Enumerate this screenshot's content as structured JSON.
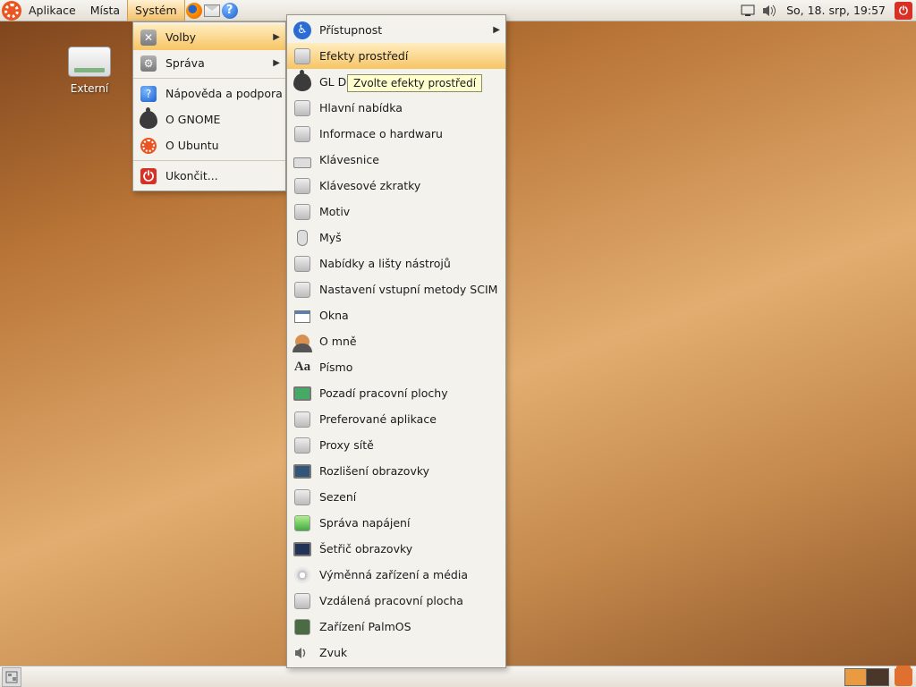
{
  "panel": {
    "apps": "Aplikace",
    "places": "Místa",
    "system": "Systém",
    "clock": "So, 18. srp, 19:57"
  },
  "desktop": {
    "drive_label": "Externí"
  },
  "menu1": {
    "preferences": "Volby",
    "administration": "Správa",
    "help": "Nápověda a podpora",
    "about_gnome": "O GNOME",
    "about_ubuntu": "O Ubuntu",
    "quit": "Ukončit..."
  },
  "menu2": {
    "accessibility": "Přístupnost",
    "desktop_effects": "Efekty prostředí",
    "gl_desktop": "GL Desktop",
    "main_menu": "Hlavní nabídka",
    "hardware_info": "Informace o hardwaru",
    "keyboard": "Klávesnice",
    "keyboard_shortcuts": "Klávesové zkratky",
    "theme": "Motiv",
    "mouse": "Myš",
    "menus_toolbars": "Nabídky a lišty nástrojů",
    "scim": "Nastavení vstupní metody SCIM",
    "windows": "Okna",
    "about_me": "O mně",
    "font": "Písmo",
    "background": "Pozadí pracovní plochy",
    "preferred_apps": "Preferované aplikace",
    "network_proxy": "Proxy sítě",
    "screen_resolution": "Rozlišení obrazovky",
    "session": "Sezení",
    "power_mgmt": "Správa napájení",
    "screensaver": "Šetřič obrazovky",
    "removable": "Výměnná zařízení a média",
    "remote_desktop": "Vzdálená pracovní plocha",
    "palmos": "Zařízení PalmOS",
    "sound": "Zvuk"
  },
  "tooltip": "Zvolte efekty prostředí"
}
